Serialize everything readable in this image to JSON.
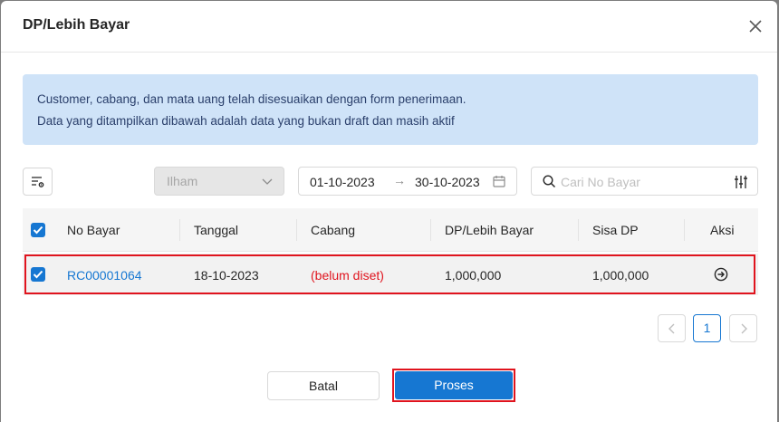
{
  "modal": {
    "title": "DP/Lebih Bayar"
  },
  "alert": {
    "line1": "Customer, cabang, dan mata uang telah disesuaikan dengan form penerimaan.",
    "line2": "Data yang ditampilkan dibawah adalah data yang bukan draft dan masih aktif"
  },
  "filters": {
    "customer_select": "Ilham",
    "date_start": "01-10-2023",
    "date_end": "30-10-2023",
    "date_separator": "→",
    "search_placeholder": "Cari No Bayar"
  },
  "table": {
    "headers": [
      "No Bayar",
      "Tanggal",
      "Cabang",
      "DP/Lebih Bayar",
      "Sisa DP",
      "Aksi"
    ],
    "rows": [
      {
        "checked": true,
        "no_bayar": "RC00001064",
        "tanggal": "18-10-2023",
        "cabang": "(belum diset)",
        "dp": "1,000,000",
        "sisa": "1,000,000"
      }
    ]
  },
  "pagination": {
    "current": "1"
  },
  "footer": {
    "cancel_label": "Batal",
    "submit_label": "Proses"
  },
  "colors": {
    "primary": "#1677d2",
    "highlight": "#e0141e",
    "alert_bg": "#cfe3f8"
  }
}
